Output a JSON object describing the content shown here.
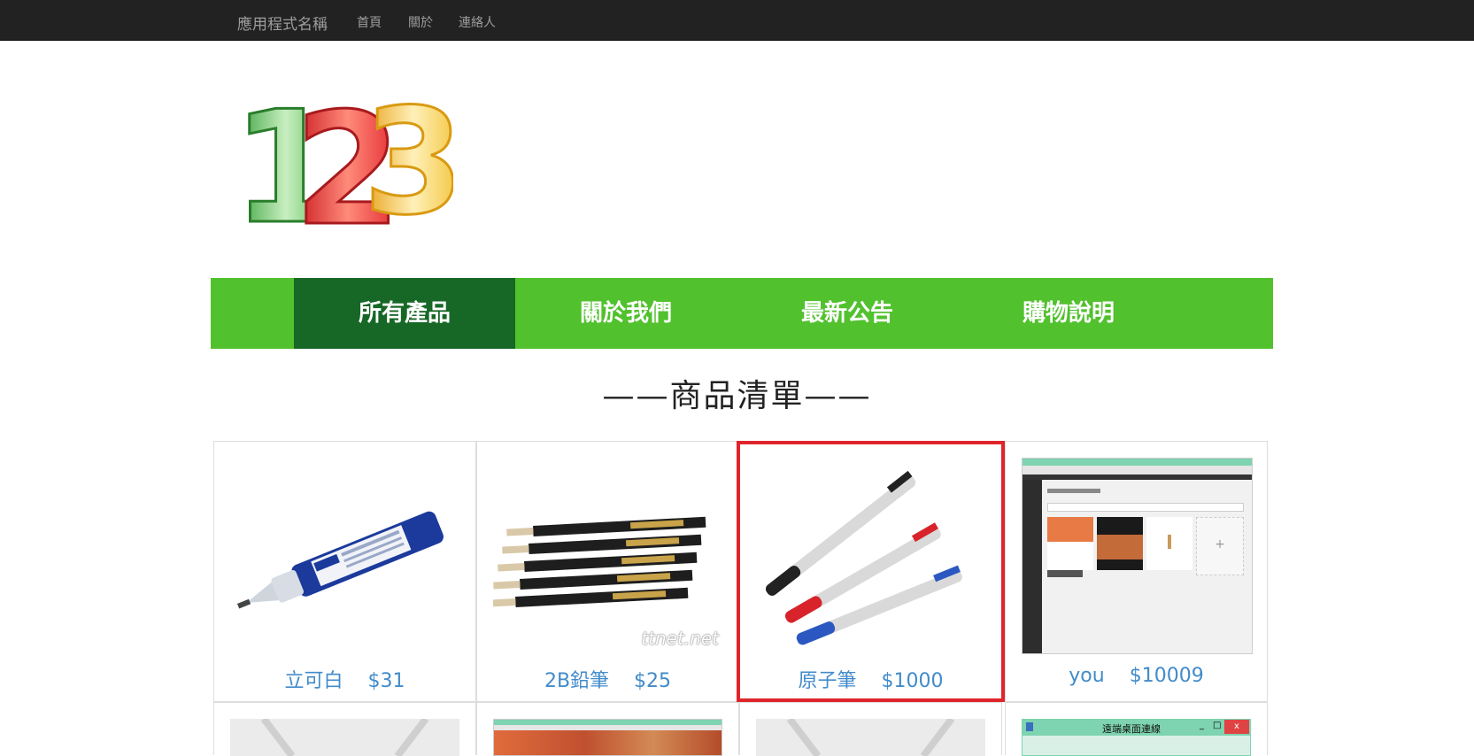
{
  "navbar": {
    "brand": "應用程式名稱",
    "links": [
      "首頁",
      "關於",
      "連絡人"
    ]
  },
  "logo": {
    "text": "123",
    "colors": [
      "#3fae3c",
      "#e0232a",
      "#f2c02f"
    ]
  },
  "menu": {
    "items": [
      "所有產品",
      "關於我們",
      "最新公告",
      "購物說明"
    ],
    "active_index": 0,
    "bg_color": "#52c12e",
    "active_color": "#176726"
  },
  "section_title": "——商品清單——",
  "products": [
    {
      "name": "立可白",
      "price": "$31",
      "image": "correction-pen"
    },
    {
      "name": "2B鉛筆",
      "price": "$25",
      "image": "pencils",
      "watermark": "ttnet.net"
    },
    {
      "name": "原子筆",
      "price": "$1000",
      "image": "ballpoint-pens",
      "highlighted": true
    },
    {
      "name": "you",
      "price": "$10009",
      "image": "screenshot"
    }
  ],
  "second_row": [
    {
      "image": "placeholder"
    },
    {
      "image": "screenshot-2"
    },
    {
      "image": "placeholder"
    },
    {
      "image": "remote-desktop",
      "title": "遠端桌面連線",
      "close_label": "x"
    }
  ]
}
